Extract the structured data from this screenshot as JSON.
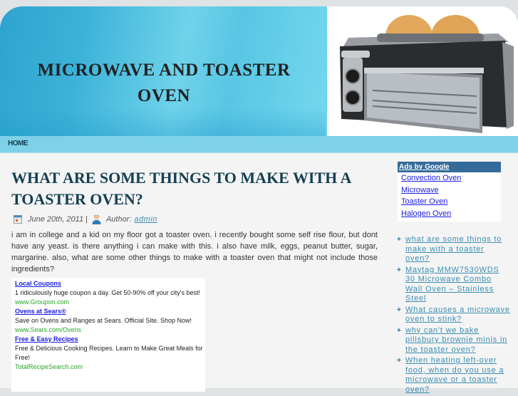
{
  "header": {
    "site_title": "MICROWAVE AND TOASTER OVEN",
    "header_image": "toaster-oven-photo"
  },
  "nav": {
    "items": [
      {
        "label": "HOME"
      }
    ]
  },
  "post": {
    "title": "WHAT ARE SOME THINGS TO MAKE WITH A TOASTER OVEN?",
    "date": "June 20th, 2011",
    "separator": "|",
    "author_label": "Author:",
    "author": "admin",
    "body": "i am in college and a kid on my floor got a toaster oven. i recently bought some self rise flour, but dont have any yeast. is there anything i can make with this. i also have milk, eggs, peanut butter, sugar, margarine. also, what are some other things to make with a toaster oven that might not include those ingredients?"
  },
  "ads": [
    {
      "title": "Local Coupons",
      "desc": "1 ridiculously huge coupon a day. Get 50-90% off your city's best!",
      "url": "www.Groupon.com"
    },
    {
      "title": "Ovens at Sears®",
      "desc": "Save on Ovens and Ranges at Sears. Official Site. Shop Now!",
      "url": "www.Sears.com/Ovens"
    },
    {
      "title": "Free & Easy Recipes",
      "desc": "Free & Delicious Cooking Recipes. Learn to Make Great Meals for Free!",
      "url": "TotalRecipeSearch.com"
    }
  ],
  "sidebar": {
    "google_ads": {
      "heading": "Ads by Google",
      "links": [
        "Convection Oven",
        "Microwave",
        "Toaster Oven",
        "Halogen Oven"
      ]
    },
    "recent_posts": [
      "what are some things to make with a toaster oven?",
      "Maytag MMW7530WDS 30 Microwave Combo Wall Oven – Stainless Steel",
      "What causes a microwave oven to stink?",
      "why can't we bake pillsbury brownie minis in the toaster oven?",
      "When heating left-over food, when do you use a microwave or a toaster oven?"
    ],
    "bullet": "+"
  }
}
